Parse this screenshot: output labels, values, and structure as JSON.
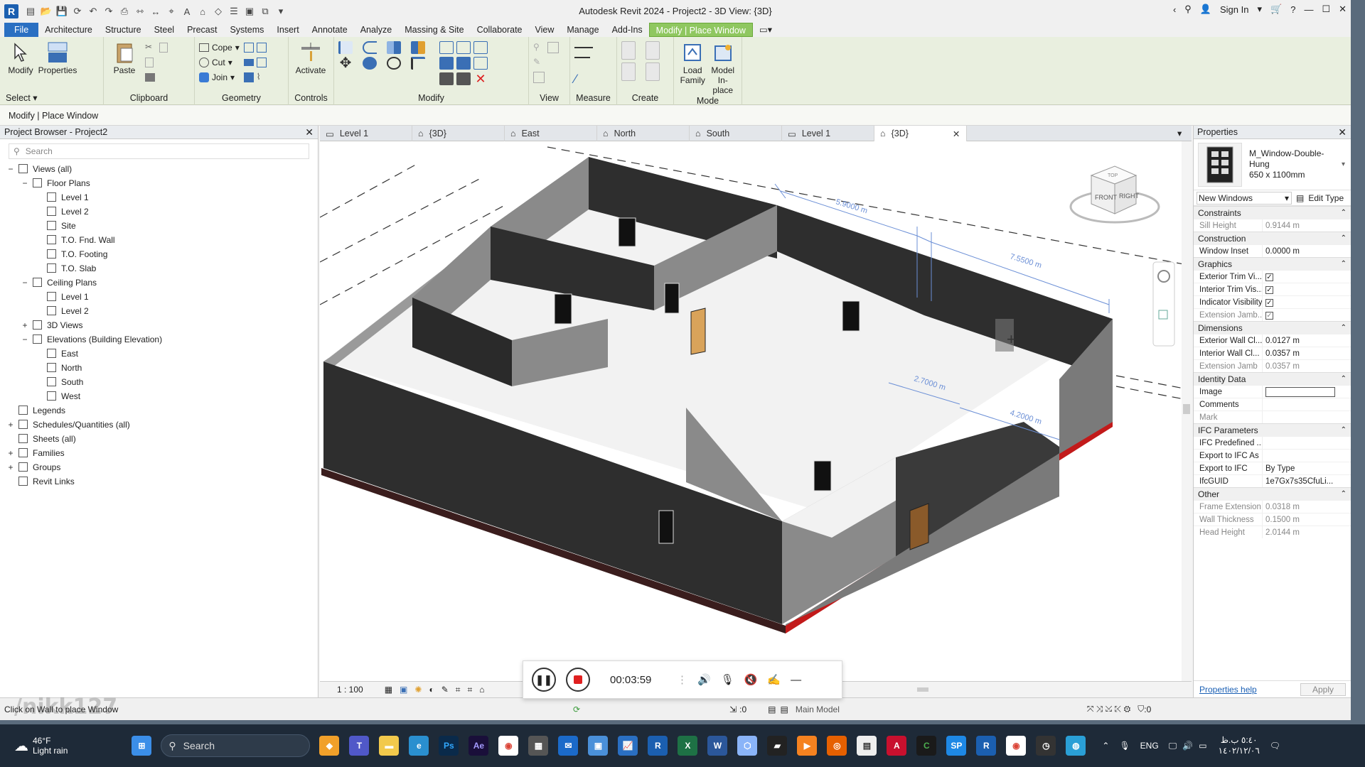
{
  "window": {
    "title": "Autodesk Revit 2024 - Project2 - 3D View: {3D}",
    "sign_in": "Sign In"
  },
  "menu": {
    "tabs": [
      "File",
      "Architecture",
      "Structure",
      "Steel",
      "Precast",
      "Systems",
      "Insert",
      "Annotate",
      "Analyze",
      "Massing & Site",
      "Collaborate",
      "View",
      "Manage",
      "Add-Ins",
      "Modify | Place Window"
    ]
  },
  "ribbon": {
    "modify_label": "Modify",
    "properties_label": "Properties",
    "select_label": "Select",
    "paste_label": "Paste",
    "clipboard_label": "Clipboard",
    "cope_label": "Cope",
    "cut_label": "Cut",
    "join_label": "Join",
    "geometry_label": "Geometry",
    "activate_label": "Activate",
    "controls_label": "Controls",
    "modify_panel_label": "Modify",
    "view_label": "View",
    "measure_label": "Measure",
    "create_label": "Create",
    "load_family_label": "Load Family",
    "model_inplace_label": "Model In-place",
    "mode_label": "Mode"
  },
  "options_bar": {
    "text": "Modify | Place Window"
  },
  "browser": {
    "title": "Project Browser - Project2",
    "search_placeholder": "Search",
    "items": [
      {
        "label": "Views (all)",
        "level": 0,
        "exp": "−"
      },
      {
        "label": "Floor Plans",
        "level": 1,
        "exp": "−"
      },
      {
        "label": "Level 1",
        "level": 2
      },
      {
        "label": "Level 2",
        "level": 2
      },
      {
        "label": "Site",
        "level": 2
      },
      {
        "label": "T.O. Fnd. Wall",
        "level": 2
      },
      {
        "label": "T.O. Footing",
        "level": 2
      },
      {
        "label": "T.O. Slab",
        "level": 2
      },
      {
        "label": "Ceiling Plans",
        "level": 1,
        "exp": "−"
      },
      {
        "label": "Level 1",
        "level": 2
      },
      {
        "label": "Level 2",
        "level": 2
      },
      {
        "label": "3D Views",
        "level": 1,
        "exp": "+"
      },
      {
        "label": "Elevations (Building Elevation)",
        "level": 1,
        "exp": "−"
      },
      {
        "label": "East",
        "level": 2
      },
      {
        "label": "North",
        "level": 2
      },
      {
        "label": "South",
        "level": 2
      },
      {
        "label": "West",
        "level": 2
      },
      {
        "label": "Legends",
        "level": 0
      },
      {
        "label": "Schedules/Quantities (all)",
        "level": 0,
        "exp": "+"
      },
      {
        "label": "Sheets (all)",
        "level": 0
      },
      {
        "label": "Families",
        "level": 0,
        "exp": "+"
      },
      {
        "label": "Groups",
        "level": 0,
        "exp": "+"
      },
      {
        "label": "Revit Links",
        "level": 0
      }
    ]
  },
  "view_tabs": [
    "Level 1",
    "{3D}",
    "East",
    "North",
    "South",
    "Level 1",
    "{3D}"
  ],
  "viewport": {
    "dims": [
      "5.9000 m",
      "7.5500 m",
      "2.7000 m",
      "4.2000 m"
    ],
    "viewcube_front": "FRONT",
    "viewcube_right": "RIGHT",
    "viewcube_top": "TOP",
    "scale": "1 : 100"
  },
  "properties": {
    "title": "Properties",
    "type_name": "M_Window-Double-Hung",
    "type_size": "650 x 1100mm",
    "filter": "New Windows",
    "edit_type": "Edit Type",
    "groups": [
      {
        "name": "Constraints",
        "rows": [
          {
            "k": "Sill Height",
            "v": "0.9144 m",
            "dis": true
          }
        ]
      },
      {
        "name": "Construction",
        "rows": [
          {
            "k": "Window Inset",
            "v": "0.0000 m"
          }
        ]
      },
      {
        "name": "Graphics",
        "rows": [
          {
            "k": "Exterior Trim Vi...",
            "chk": true
          },
          {
            "k": "Interior Trim Vis...",
            "chk": true
          },
          {
            "k": "Indicator Visibility",
            "chk": true
          },
          {
            "k": "Extension Jamb...",
            "chk": true,
            "dis": true
          }
        ]
      },
      {
        "name": "Dimensions",
        "rows": [
          {
            "k": "Exterior Wall Cl...",
            "v": "0.0127 m"
          },
          {
            "k": "Interior Wall Cl...",
            "v": "0.0357 m"
          },
          {
            "k": "Extension Jamb",
            "v": "0.0357 m",
            "dis": true
          }
        ]
      },
      {
        "name": "Identity Data",
        "rows": [
          {
            "k": "Image",
            "v": "",
            "box": true
          },
          {
            "k": "Comments",
            "v": ""
          },
          {
            "k": "Mark",
            "v": "",
            "dis": true
          }
        ]
      },
      {
        "name": "IFC Parameters",
        "rows": [
          {
            "k": "IFC Predefined ...",
            "v": ""
          },
          {
            "k": "Export to IFC As",
            "v": ""
          },
          {
            "k": "Export to IFC",
            "v": "By Type"
          },
          {
            "k": "IfcGUID",
            "v": "1e7Gx7s35CfuLi..."
          }
        ]
      },
      {
        "name": "Other",
        "rows": [
          {
            "k": "Frame Extension",
            "v": "0.0318 m",
            "dis": true
          },
          {
            "k": "Wall Thickness",
            "v": "0.1500 m",
            "dis": true
          },
          {
            "k": "Head Height",
            "v": "2.0144 m",
            "dis": true
          }
        ]
      }
    ],
    "help": "Properties help",
    "apply": "Apply"
  },
  "status": {
    "message": "Click on Wall to place Window",
    "zero1": ":0",
    "model": "Main Model",
    "filter_count": ":0"
  },
  "recorder": {
    "time": "00:03:59"
  },
  "taskbar": {
    "temp": "46°F",
    "weather": "Light rain",
    "search": "Search",
    "lang": "ENG",
    "clock_time": "٥:٤٠ ب.ظ",
    "clock_date": "١٤٠٢/١٢/٠٦"
  },
  "watermark": "/nikk127",
  "colors": {
    "file_tab": "#2a6fc2",
    "active_tab": "#8fc760",
    "ribbon_bg": "#e9efdf",
    "wall_dark": "#2e2e2e",
    "floor_red": "#c21a1a"
  }
}
